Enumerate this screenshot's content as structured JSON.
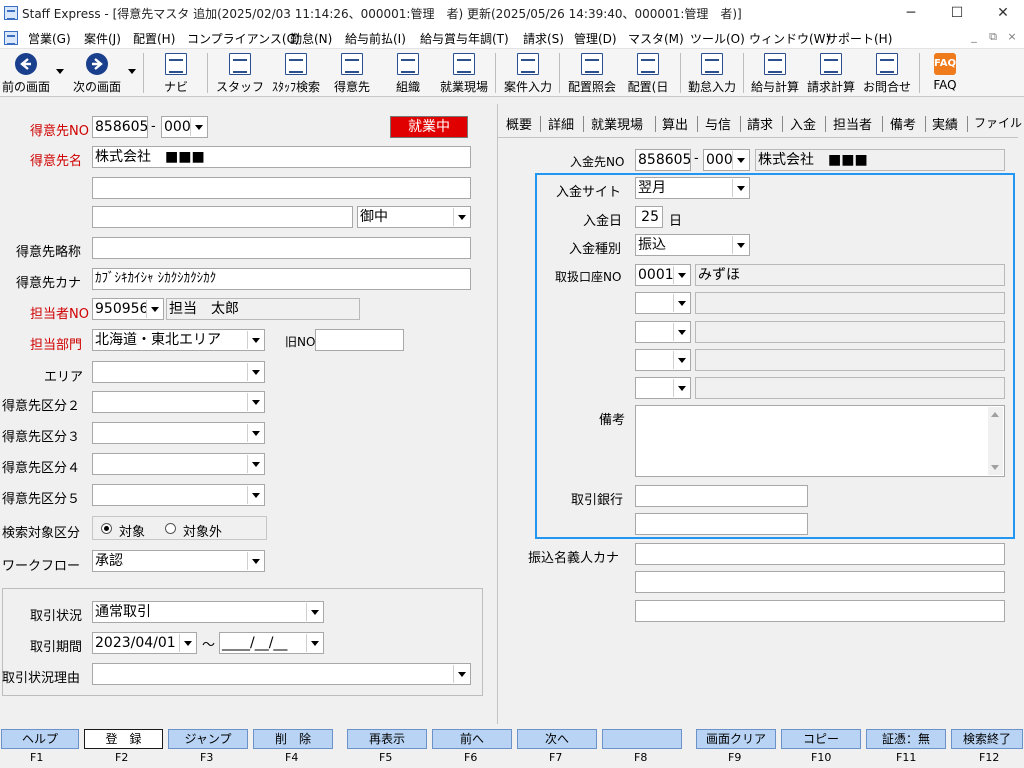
{
  "window": {
    "title": "Staff Express - [得意先マスタ 追加(2025/02/03 11:14:26、000001:管理　者) 更新(2025/05/26 14:39:40、000001:管理　者)]",
    "minimize": "─",
    "maximize": "☐",
    "close": "✕"
  },
  "menu": [
    "営業(G)",
    "案件(J)",
    "配置(H)",
    "コンプライアンス(C)",
    "勤怠(N)",
    "給与前払(I)",
    "給与賞与年調(T)",
    "請求(S)",
    "管理(D)",
    "マスタ(M)",
    "ツール(O)",
    "ウィンドウ(W)",
    "サポート(H)"
  ],
  "mdi": {
    "min": "_",
    "restore": "⧉",
    "close": "×"
  },
  "toolbar": [
    {
      "label": "前の画面",
      "icon": "back-arrow-icon"
    },
    {
      "label": "次の画面",
      "icon": "forward-arrow-icon"
    },
    {
      "label": "ナビ",
      "icon": "navi-icon"
    },
    {
      "label": "スタッフ",
      "icon": "staff-icon"
    },
    {
      "label": "ｽﾀｯﾌ検索",
      "icon": "staff-search-icon"
    },
    {
      "label": "得意先",
      "icon": "customer-icon"
    },
    {
      "label": "組織",
      "icon": "organization-icon"
    },
    {
      "label": "就業現場",
      "icon": "worksite-icon"
    },
    {
      "label": "案件入力",
      "icon": "project-input-icon"
    },
    {
      "label": "配置照会",
      "icon": "placement-inquiry-icon"
    },
    {
      "label": "配置(日",
      "icon": "placement-daily-icon"
    },
    {
      "label": "勤怠入力",
      "icon": "attendance-input-icon"
    },
    {
      "label": "給与計算",
      "icon": "payroll-icon"
    },
    {
      "label": "請求計算",
      "icon": "billing-icon"
    },
    {
      "label": "お問合せ",
      "icon": "inquiry-icon"
    },
    {
      "label": "FAQ",
      "icon": "faq-icon"
    }
  ],
  "form": {
    "customer_no_label": "得意先NO",
    "customer_no": "858605",
    "customer_no_dash": "-",
    "customer_branch": "000",
    "status": "就業中",
    "customer_name_label": "得意先名",
    "customer_name": "株式会社　■■■",
    "customer_name2": "",
    "customer_name3": "",
    "honorific": "御中",
    "short_name_label": "得意先略称",
    "short_name": "",
    "kana_label": "得意先カナ",
    "kana": "ｶﾌﾞｼｷｶｲｼｬ ｼｶｸｼｶｸｼｶｸ",
    "staff_no_label": "担当者NO",
    "staff_no": "950956",
    "staff_name": "担当　太郎",
    "dept_label": "担当部門",
    "dept": "北海道・東北エリア",
    "old_no_label": "旧NO",
    "old_no": "",
    "area_label": "エリア",
    "class2_label": "得意先区分２",
    "class3_label": "得意先区分３",
    "class4_label": "得意先区分４",
    "class5_label": "得意先区分５",
    "search_target_label": "検索対象区分",
    "search_target_on": "対象",
    "search_target_off": "対象外",
    "workflow_label": "ワークフロー",
    "workflow": "承認",
    "trade_status_label": "取引状況",
    "trade_status": "通常取引",
    "trade_period_label": "取引期間",
    "trade_from": "2023/04/01",
    "trade_tilde": "～",
    "trade_to": "____/__/__",
    "trade_reason_label": "取引状況理由",
    "trade_reason": ""
  },
  "tabs": [
    "概要",
    "詳細",
    "就業現場",
    "算出",
    "与信",
    "請求",
    "入金",
    "担当者",
    "備考",
    "実績",
    "ファイル"
  ],
  "payment": {
    "payee_no_label": "入金先NO",
    "payee_no": "858605",
    "payee_dash": "-",
    "payee_branch": "000",
    "payee_name": "株式会社　■■■",
    "site_label": "入金サイト",
    "site": "翌月",
    "day_label": "入金日",
    "day": "25",
    "day_unit": "日",
    "type_label": "入金種別",
    "type": "振込",
    "account_label": "取扱口座NO",
    "account_no": "0001",
    "account_name": "みずほ",
    "note_label": "備考",
    "bank_label": "取引銀行",
    "transfer_name_label": "振込名義人カナ"
  },
  "fkeys": [
    {
      "label": "ヘルプ",
      "key": "F1"
    },
    {
      "label": "登　録",
      "key": "F2"
    },
    {
      "label": "ジャンプ",
      "key": "F3"
    },
    {
      "label": "削　除",
      "key": "F4"
    },
    {
      "label": "再表示",
      "key": "F5"
    },
    {
      "label": "前へ",
      "key": "F6"
    },
    {
      "label": "次へ",
      "key": "F7"
    },
    {
      "label": "",
      "key": "F8"
    },
    {
      "label": "画面クリア",
      "key": "F9"
    },
    {
      "label": "コピー",
      "key": "F10"
    },
    {
      "label": "証憑：無",
      "key": "F11"
    },
    {
      "label": "検索終了",
      "key": "F12"
    }
  ],
  "colors": {
    "accent": "#2196f3",
    "status": "#e00000",
    "required_label": "#d00000",
    "fkey": "#b8d3f4"
  }
}
